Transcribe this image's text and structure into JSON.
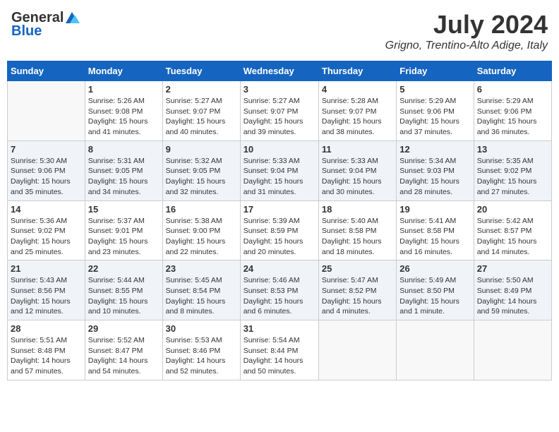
{
  "logo": {
    "general": "General",
    "blue": "Blue"
  },
  "title": {
    "month": "July 2024",
    "location": "Grigno, Trentino-Alto Adige, Italy"
  },
  "headers": [
    "Sunday",
    "Monday",
    "Tuesday",
    "Wednesday",
    "Thursday",
    "Friday",
    "Saturday"
  ],
  "weeks": [
    [
      {
        "day": "",
        "info": ""
      },
      {
        "day": "1",
        "info": "Sunrise: 5:26 AM\nSunset: 9:08 PM\nDaylight: 15 hours\nand 41 minutes."
      },
      {
        "day": "2",
        "info": "Sunrise: 5:27 AM\nSunset: 9:07 PM\nDaylight: 15 hours\nand 40 minutes."
      },
      {
        "day": "3",
        "info": "Sunrise: 5:27 AM\nSunset: 9:07 PM\nDaylight: 15 hours\nand 39 minutes."
      },
      {
        "day": "4",
        "info": "Sunrise: 5:28 AM\nSunset: 9:07 PM\nDaylight: 15 hours\nand 38 minutes."
      },
      {
        "day": "5",
        "info": "Sunrise: 5:29 AM\nSunset: 9:06 PM\nDaylight: 15 hours\nand 37 minutes."
      },
      {
        "day": "6",
        "info": "Sunrise: 5:29 AM\nSunset: 9:06 PM\nDaylight: 15 hours\nand 36 minutes."
      }
    ],
    [
      {
        "day": "7",
        "info": "Sunrise: 5:30 AM\nSunset: 9:06 PM\nDaylight: 15 hours\nand 35 minutes."
      },
      {
        "day": "8",
        "info": "Sunrise: 5:31 AM\nSunset: 9:05 PM\nDaylight: 15 hours\nand 34 minutes."
      },
      {
        "day": "9",
        "info": "Sunrise: 5:32 AM\nSunset: 9:05 PM\nDaylight: 15 hours\nand 32 minutes."
      },
      {
        "day": "10",
        "info": "Sunrise: 5:33 AM\nSunset: 9:04 PM\nDaylight: 15 hours\nand 31 minutes."
      },
      {
        "day": "11",
        "info": "Sunrise: 5:33 AM\nSunset: 9:04 PM\nDaylight: 15 hours\nand 30 minutes."
      },
      {
        "day": "12",
        "info": "Sunrise: 5:34 AM\nSunset: 9:03 PM\nDaylight: 15 hours\nand 28 minutes."
      },
      {
        "day": "13",
        "info": "Sunrise: 5:35 AM\nSunset: 9:02 PM\nDaylight: 15 hours\nand 27 minutes."
      }
    ],
    [
      {
        "day": "14",
        "info": "Sunrise: 5:36 AM\nSunset: 9:02 PM\nDaylight: 15 hours\nand 25 minutes."
      },
      {
        "day": "15",
        "info": "Sunrise: 5:37 AM\nSunset: 9:01 PM\nDaylight: 15 hours\nand 23 minutes."
      },
      {
        "day": "16",
        "info": "Sunrise: 5:38 AM\nSunset: 9:00 PM\nDaylight: 15 hours\nand 22 minutes."
      },
      {
        "day": "17",
        "info": "Sunrise: 5:39 AM\nSunset: 8:59 PM\nDaylight: 15 hours\nand 20 minutes."
      },
      {
        "day": "18",
        "info": "Sunrise: 5:40 AM\nSunset: 8:58 PM\nDaylight: 15 hours\nand 18 minutes."
      },
      {
        "day": "19",
        "info": "Sunrise: 5:41 AM\nSunset: 8:58 PM\nDaylight: 15 hours\nand 16 minutes."
      },
      {
        "day": "20",
        "info": "Sunrise: 5:42 AM\nSunset: 8:57 PM\nDaylight: 15 hours\nand 14 minutes."
      }
    ],
    [
      {
        "day": "21",
        "info": "Sunrise: 5:43 AM\nSunset: 8:56 PM\nDaylight: 15 hours\nand 12 minutes."
      },
      {
        "day": "22",
        "info": "Sunrise: 5:44 AM\nSunset: 8:55 PM\nDaylight: 15 hours\nand 10 minutes."
      },
      {
        "day": "23",
        "info": "Sunrise: 5:45 AM\nSunset: 8:54 PM\nDaylight: 15 hours\nand 8 minutes."
      },
      {
        "day": "24",
        "info": "Sunrise: 5:46 AM\nSunset: 8:53 PM\nDaylight: 15 hours\nand 6 minutes."
      },
      {
        "day": "25",
        "info": "Sunrise: 5:47 AM\nSunset: 8:52 PM\nDaylight: 15 hours\nand 4 minutes."
      },
      {
        "day": "26",
        "info": "Sunrise: 5:49 AM\nSunset: 8:50 PM\nDaylight: 15 hours\nand 1 minute."
      },
      {
        "day": "27",
        "info": "Sunrise: 5:50 AM\nSunset: 8:49 PM\nDaylight: 14 hours\nand 59 minutes."
      }
    ],
    [
      {
        "day": "28",
        "info": "Sunrise: 5:51 AM\nSunset: 8:48 PM\nDaylight: 14 hours\nand 57 minutes."
      },
      {
        "day": "29",
        "info": "Sunrise: 5:52 AM\nSunset: 8:47 PM\nDaylight: 14 hours\nand 54 minutes."
      },
      {
        "day": "30",
        "info": "Sunrise: 5:53 AM\nSunset: 8:46 PM\nDaylight: 14 hours\nand 52 minutes."
      },
      {
        "day": "31",
        "info": "Sunrise: 5:54 AM\nSunset: 8:44 PM\nDaylight: 14 hours\nand 50 minutes."
      },
      {
        "day": "",
        "info": ""
      },
      {
        "day": "",
        "info": ""
      },
      {
        "day": "",
        "info": ""
      }
    ]
  ]
}
